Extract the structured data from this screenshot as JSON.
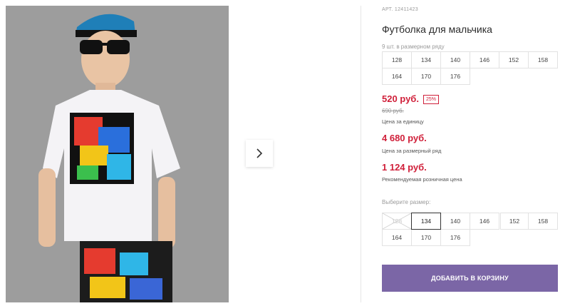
{
  "product": {
    "sku": "АРТ. 12411423",
    "title": "Футболка для мальчика",
    "photo_label": "product-photo-boy-tshirt"
  },
  "pack": {
    "label": "9 шт. в размерном ряду",
    "sizes": [
      "128",
      "134",
      "140",
      "146",
      "152",
      "158",
      "164",
      "170",
      "176"
    ]
  },
  "pricing": {
    "unit_price": "520 руб.",
    "discount": "25%",
    "old_price": "690 руб.",
    "unit_caption": "Цена за единицу",
    "pack_price": "4 680 руб.",
    "pack_caption": "Цена за размерный ряд",
    "retail_price": "1 124 руб.",
    "retail_caption": "Рекомендуемая розничная цена"
  },
  "size_select": {
    "label": "Выберите размер:",
    "selected": "134",
    "unavailable": [
      "128"
    ],
    "sizes": [
      "128",
      "134",
      "140",
      "146",
      "152",
      "158",
      "164",
      "170",
      "176"
    ]
  },
  "actions": {
    "add_to_cart": "ДОБАВИТЬ В КОРЗИНУ",
    "next_icon": "chevron-right-icon"
  },
  "colors": {
    "accent": "#7b66a6",
    "price": "#d0203a"
  }
}
